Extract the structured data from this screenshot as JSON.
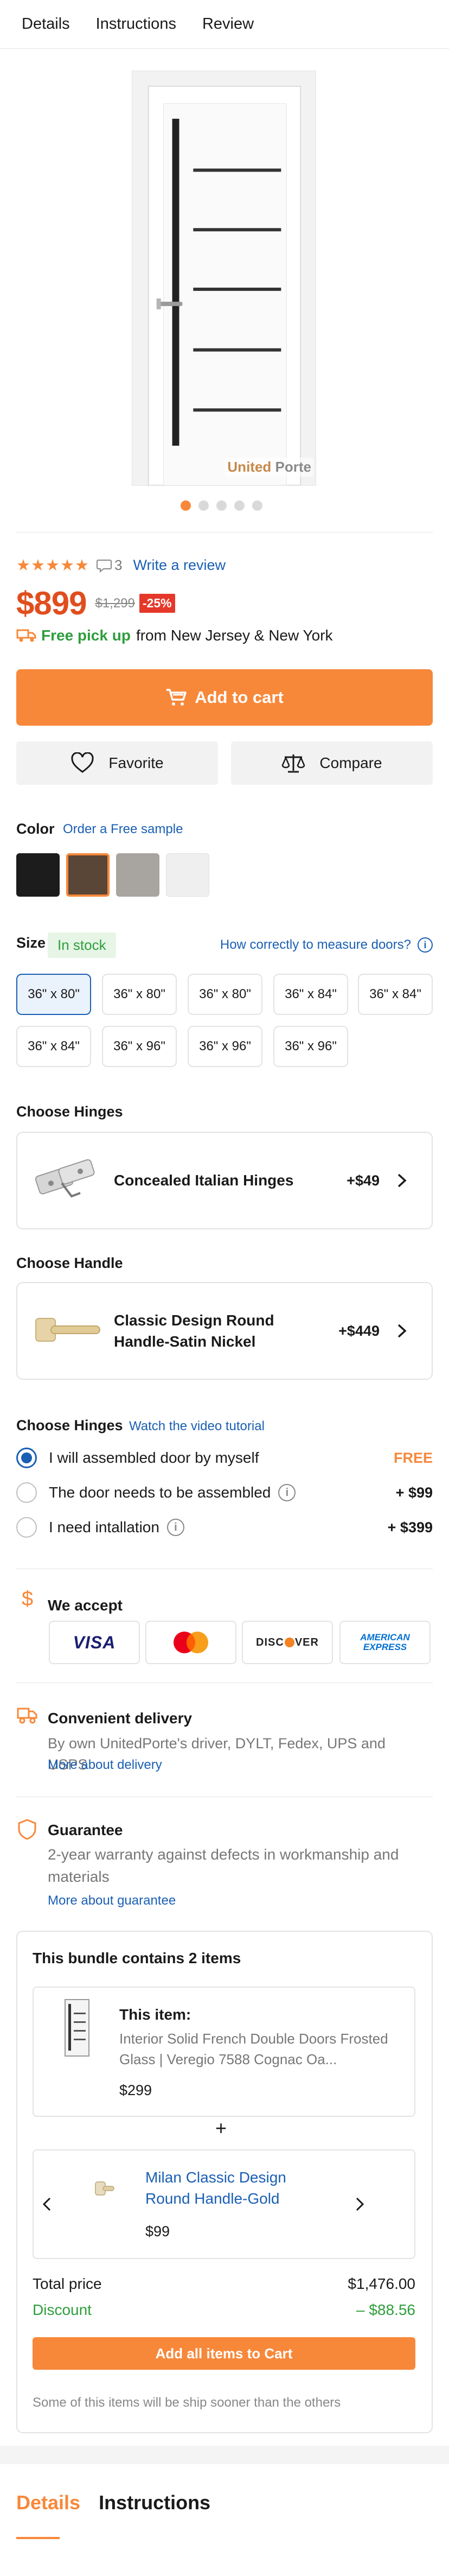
{
  "tabs": [
    "Details",
    "Instructions",
    "Review"
  ],
  "gallery": {
    "brand_logo_text": "United",
    "brand_logo_text_2": "Porte",
    "dots_count": 5,
    "active_dot": 0
  },
  "rating": {
    "stars": "★★★★★",
    "comments_count": "3",
    "write_review": "Write a review"
  },
  "price": {
    "current": "$899",
    "old": "$1,299",
    "discount": "-25%"
  },
  "pickup": {
    "strong": "Free pick up",
    "text": "from New Jersey & New York"
  },
  "actions": {
    "add_to_cart": "Add to cart",
    "favorite": "Favorite",
    "compare": "Compare"
  },
  "color": {
    "label": "Color",
    "order_sample": "Order a Free sample",
    "swatches": [
      "#1c1c1c",
      "#5a4636",
      "#a8a5a1",
      "#efefef"
    ],
    "selected_index": 1
  },
  "size": {
    "label": "Size",
    "stock": "In stock",
    "measure_link": "How correctly to measure doors?",
    "options": [
      "36\" x 80\"",
      "36\" x 80\"",
      "36\" x 80\"",
      "36\" x 84\"",
      "36\" x 84\"",
      "36\" x 84\"",
      "36\" x 96\"",
      "36\" x 96\"",
      "36\" x 96\""
    ],
    "selected_index": 0
  },
  "hinges": {
    "label": "Choose Hinges",
    "name": "Concealed Italian Hinges",
    "price": "+$49"
  },
  "handle": {
    "label": "Choose Handle",
    "name_line1": "Classic Design Round",
    "name_line2": "Handle-Satin Nickel",
    "price": "+$449"
  },
  "assembly": {
    "label": "Choose Hinges",
    "video_link": "Watch the video tutorial",
    "options": [
      {
        "label": "I will assembled door by myself",
        "price": "FREE"
      },
      {
        "label": "The door needs to be assembled",
        "price": "+ $99"
      },
      {
        "label": "I need intallation",
        "price": "+ $399"
      }
    ]
  },
  "payment": {
    "title": "We accept",
    "cards": [
      "VISA",
      "mastercard",
      "DISC",
      "VER",
      "AMERICAN",
      "EXPRESS"
    ]
  },
  "delivery": {
    "title": "Convenient delivery",
    "text": "By own UnitedPorte's driver, DYLT, Fedex, UPS and USPS",
    "link": "More about delivery"
  },
  "guarantee": {
    "title": "Guarantee",
    "text": "2-year warranty against defects in workmanship and materials",
    "link": "More about guarantee"
  },
  "bundle": {
    "title": "This bundle contains 2 items",
    "item1_label": "This item:",
    "item1_desc": "Interior Solid French Double Doors Frosted Glass | Veregio 7588 Cognac Oa...",
    "item1_price": "$299",
    "plus": "+",
    "item2_name": "Milan Classic Design Round Handle-Gold",
    "item2_price": "$99",
    "total_label": "Total price",
    "total_value": "$1,476.00",
    "discount_label": "Discount",
    "discount_value": "– $88.56",
    "button": "Add all items to Cart",
    "note": "Some of this items will be ship sooner than the others"
  },
  "bottom_tabs": [
    "Details",
    "Instructions"
  ],
  "colors": {
    "accent": "#f7883a",
    "link": "#1a5fb4",
    "price": "#e04e1d",
    "success": "#2e9e3c"
  }
}
